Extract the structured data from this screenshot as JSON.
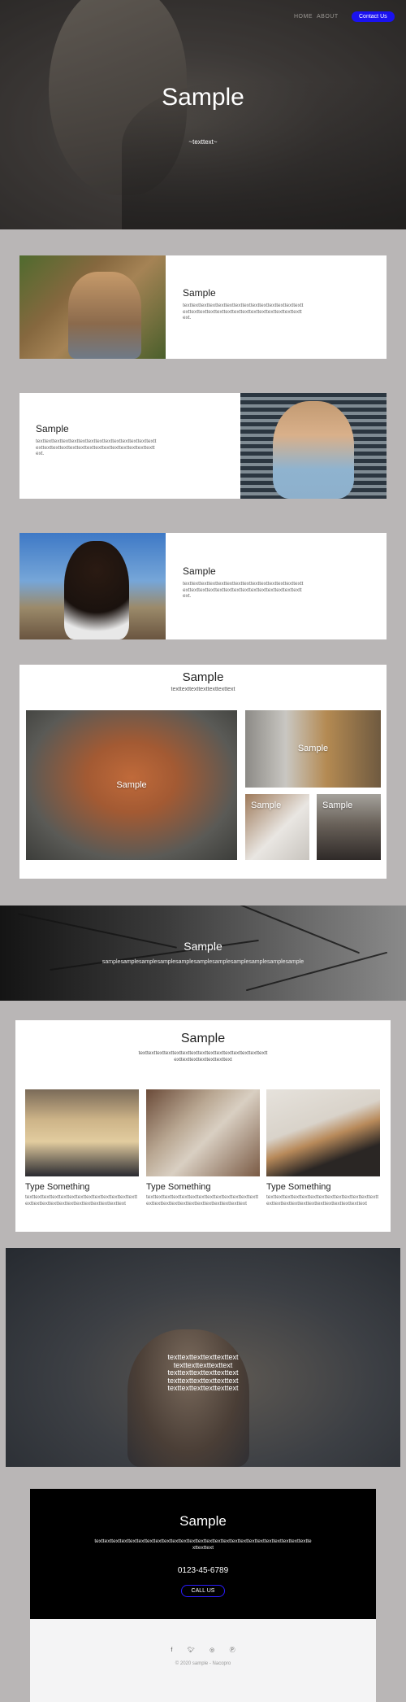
{
  "nav": {
    "items": [
      "HOME",
      "ABOUT"
    ],
    "cta": "Contact Us"
  },
  "hero": {
    "title": "Sample",
    "subtitle": "~texttext~"
  },
  "features": [
    {
      "title": "Sample",
      "text": "texttexttexttexttexttexttexttexttexttexttexttexttexttexttexttexttexttexttexttexttexttexttexttexttexttexttexttexttext."
    },
    {
      "title": "Sample",
      "text": "texttexttexttexttexttexttexttexttexttexttexttexttexttexttexttexttexttexttexttexttexttexttexttexttexttexttexttexttext."
    },
    {
      "title": "Sample",
      "text": "texttexttexttexttexttexttexttexttexttexttexttexttexttexttexttexttexttexttexttexttexttexttexttexttexttexttexttexttext."
    }
  ],
  "gallery": {
    "title": "Sample",
    "subtitle": "texttexttexttexttexttexttext",
    "tiles": [
      "Sample",
      "Sample",
      "Sample",
      "Sample"
    ]
  },
  "banner": {
    "title": "Sample",
    "text": "samplesamplesamplesamplesamplesamplesamplesamplesamplesamplesample"
  },
  "columns": {
    "title": "Sample",
    "intro": "texttexttexttexttexttexttexttexttexttexttexttexttexttexttexttexttexttexttexttexttexttext",
    "items": [
      {
        "title": "Type Something",
        "text": "texttexttexttexttexttexttexttexttexttexttexttexttexttexttexttexttexttexttexttexttexttexttexttexttext"
      },
      {
        "title": "Type Something",
        "text": "texttexttexttexttexttexttexttexttexttexttexttexttexttexttexttexttexttexttexttexttexttexttexttexttext"
      },
      {
        "title": "Type Something",
        "text": "texttexttexttexttexttexttexttexttexttexttexttexttexttexttexttexttexttexttexttexttexttexttexttexttext"
      }
    ]
  },
  "quote": {
    "lines": [
      "texttexttexttexttexttext",
      "texttexttexttexttext",
      "texttexttexttexttexttext",
      "texttexttexttexttexttext",
      "texttexttexttexttexttext"
    ]
  },
  "cta": {
    "title": "Sample",
    "text": "texttexttexttexttexttexttexttexttexttexttexttexttexttexttexttexttexttexttexttexttexttexttexttexttexttexttexttext",
    "phone": "0123-45-6789",
    "button": "CALL US"
  },
  "footer": {
    "social": [
      "facebook-icon",
      "twitter-icon",
      "instagram-icon",
      "pinterest-icon"
    ],
    "copyright": "© 2020 sample - Nacopro"
  }
}
